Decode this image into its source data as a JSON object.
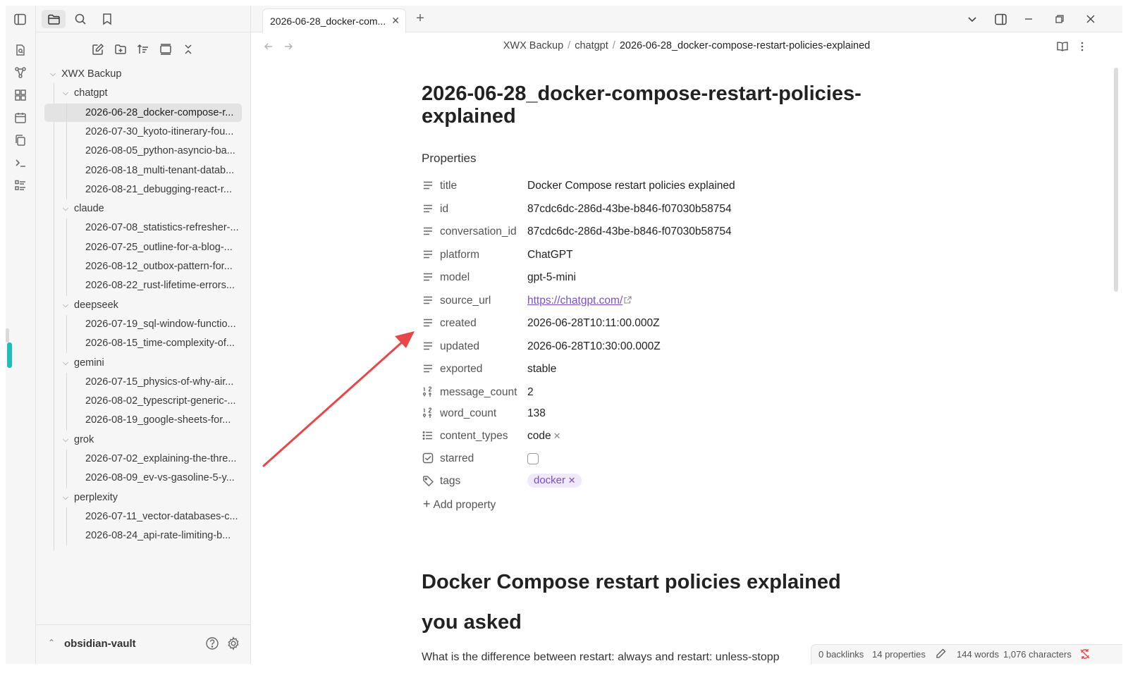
{
  "sidebar": {
    "vault_root": "XWX Backup",
    "folders": [
      {
        "name": "chatgpt",
        "files": [
          "2026-06-28_docker-compose-r...",
          "2026-07-30_kyoto-itinerary-fou...",
          "2026-08-05_python-asyncio-ba...",
          "2026-08-18_multi-tenant-datab...",
          "2026-08-21_debugging-react-r..."
        ]
      },
      {
        "name": "claude",
        "files": [
          "2026-07-08_statistics-refresher-...",
          "2026-07-25_outline-for-a-blog-...",
          "2026-08-12_outbox-pattern-for...",
          "2026-08-22_rust-lifetime-errors..."
        ]
      },
      {
        "name": "deepseek",
        "files": [
          "2026-07-19_sql-window-functio...",
          "2026-08-15_time-complexity-of..."
        ]
      },
      {
        "name": "gemini",
        "files": [
          "2026-07-15_physics-of-why-air...",
          "2026-08-02_typescript-generic-...",
          "2026-08-19_google-sheets-for..."
        ]
      },
      {
        "name": "grok",
        "files": [
          "2026-07-02_explaining-the-thre...",
          "2026-08-09_ev-vs-gasoline-5-y..."
        ]
      },
      {
        "name": "perplexity",
        "files": [
          "2026-07-11_vector-databases-c...",
          "2026-08-24_api-rate-limiting-b..."
        ]
      }
    ],
    "vault_name": "obsidian-vault"
  },
  "tab": {
    "title": "2026-06-28_docker-com...",
    "close": "✕",
    "new": "+"
  },
  "breadcrumb": {
    "root": "XWX Backup",
    "folder": "chatgpt",
    "file": "2026-06-28_docker-compose-restart-policies-explained",
    "sep": "/"
  },
  "note": {
    "title": "2026-06-28_docker-compose-restart-policies-explained",
    "properties_heading": "Properties",
    "properties": [
      {
        "key": "title",
        "value": "Docker Compose restart policies explained",
        "icon": "text-icon"
      },
      {
        "key": "id",
        "value": "87cdc6dc-286d-43be-b846-f07030b58754",
        "icon": "text-icon"
      },
      {
        "key": "conversation_id",
        "value": "87cdc6dc-286d-43be-b846-f07030b58754",
        "icon": "text-icon"
      },
      {
        "key": "platform",
        "value": "ChatGPT",
        "icon": "text-icon"
      },
      {
        "key": "model",
        "value": "gpt-5-mini",
        "icon": "text-icon"
      },
      {
        "key": "source_url",
        "value": "https://chatgpt.com/",
        "icon": "text-icon"
      },
      {
        "key": "created",
        "value": "2026-06-28T10:11:00.000Z",
        "icon": "text-icon"
      },
      {
        "key": "updated",
        "value": "2026-06-28T10:30:00.000Z",
        "icon": "text-icon"
      },
      {
        "key": "exported",
        "value": "stable",
        "icon": "text-icon"
      },
      {
        "key": "message_count",
        "value": "2",
        "icon": "number-icon"
      },
      {
        "key": "word_count",
        "value": "138",
        "icon": "number-icon"
      },
      {
        "key": "content_types",
        "value": "code",
        "icon": "list-icon"
      },
      {
        "key": "starred",
        "value": "",
        "icon": "checkbox-icon"
      },
      {
        "key": "tags",
        "value": "docker",
        "icon": "tag-icon"
      }
    ],
    "add_property": "Add property",
    "heading1": "Docker Compose restart policies explained",
    "heading2": "you asked",
    "paragraph": "What is the difference between restart: always and restart: unless-stopp"
  },
  "status": {
    "backlinks": "0 backlinks",
    "properties": "14 properties",
    "words": "144 words",
    "characters": "1,076 characters"
  },
  "colors": {
    "accent": "#7b4fc9",
    "ribbon_marker": "#1fbfb8",
    "annotation_arrow": "#e8474a"
  }
}
